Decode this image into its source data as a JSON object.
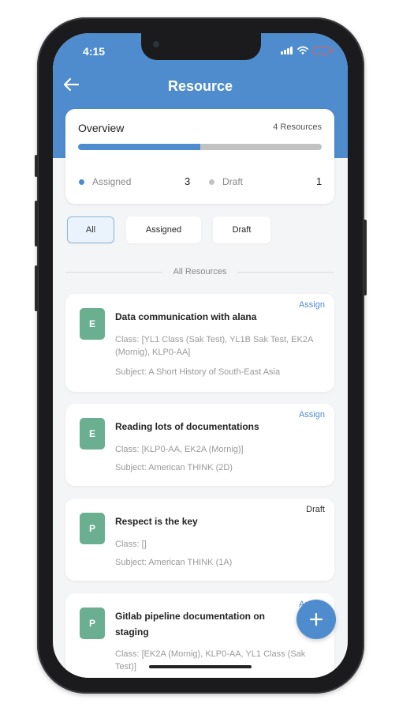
{
  "status_bar": {
    "time": "4:15"
  },
  "header": {
    "title": "Resource"
  },
  "overview": {
    "title": "Overview",
    "count_label": "4 Resources",
    "assigned_fraction": 0.5,
    "assigned_label": "Assigned",
    "assigned_count": "3",
    "draft_label": "Draft",
    "draft_count": "1"
  },
  "filters": [
    {
      "label": "All",
      "active": true
    },
    {
      "label": "Assigned",
      "active": false
    },
    {
      "label": "Draft",
      "active": false
    }
  ],
  "section_label": "All Resources",
  "resources": [
    {
      "letter": "E",
      "title": "Data communication with alana",
      "action": "Assign",
      "class_line": "Class: [YL1 Class (Sak Test), YL1B Sak Test, EK2A (Mornig), KLP0-AA]",
      "subject_line": "Subject: A Short History of South-East Asia"
    },
    {
      "letter": "E",
      "title": "Reading lots of documentations",
      "action": "Assign",
      "class_line": "Class: [KLP0-AA, EK2A (Mornig)]",
      "subject_line": "Subject: American THINK (2D)"
    },
    {
      "letter": "P",
      "title": "Respect is the key",
      "status": "Draft",
      "class_line": "Class: []",
      "subject_line": "Subject: American THINK (1A)"
    },
    {
      "letter": "P",
      "title": "Gitlab pipeline documentation on staging",
      "action": "Assign",
      "class_line": "Class: [EK2A (Mornig), KLP0-AA, YL1 Class (Sak Test)]"
    }
  ],
  "fab_icon": "plus-icon",
  "colors": {
    "primary": "#4f8ccd",
    "avatar": "#6aaf8f",
    "draft_dot": "#c2c2c2"
  }
}
